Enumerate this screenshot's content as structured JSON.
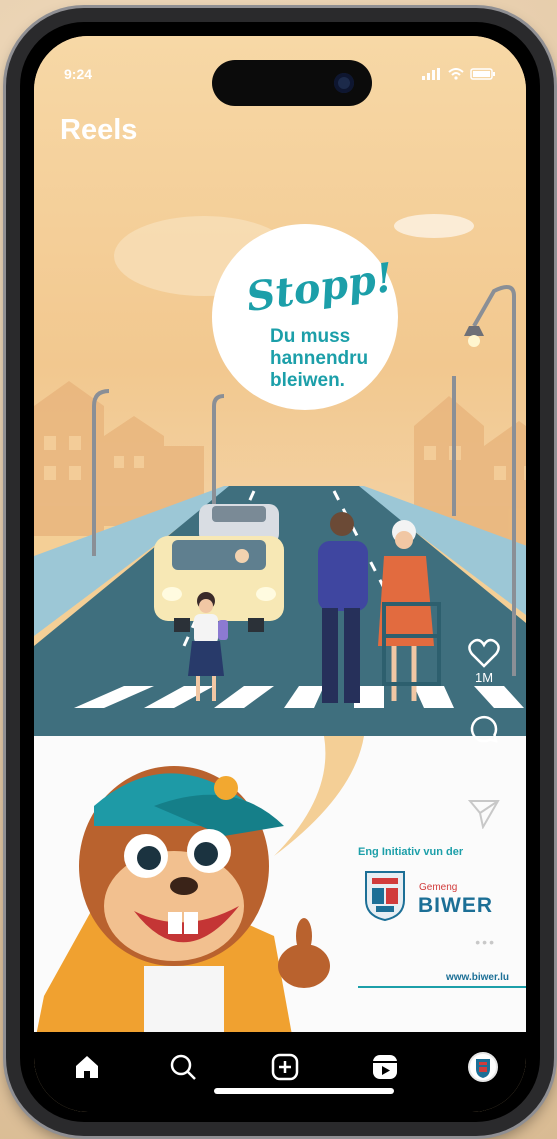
{
  "status_bar": {
    "time": "9:24"
  },
  "header": {
    "title": "Reels"
  },
  "poster": {
    "headline": "Stopp!",
    "subline": "Du muss hannendru bleiwen.",
    "initiative": "Eng Initiativ vun der",
    "org_small": "Gemeng",
    "org_name": "BIWER",
    "website": "www.biwer.lu"
  },
  "reel_actions": {
    "like_count": "1M",
    "icons": [
      "heart-icon",
      "comment-icon",
      "share-icon",
      "more-icon"
    ]
  },
  "bottom_nav": {
    "items": [
      "home-icon",
      "search-icon",
      "create-icon",
      "reels-icon",
      "profile-avatar"
    ]
  },
  "colors": {
    "teal": "#1c9fa9",
    "biwer_blue": "#1c6f96",
    "road": "#3f6f7e",
    "sky": "#f4cf96"
  }
}
